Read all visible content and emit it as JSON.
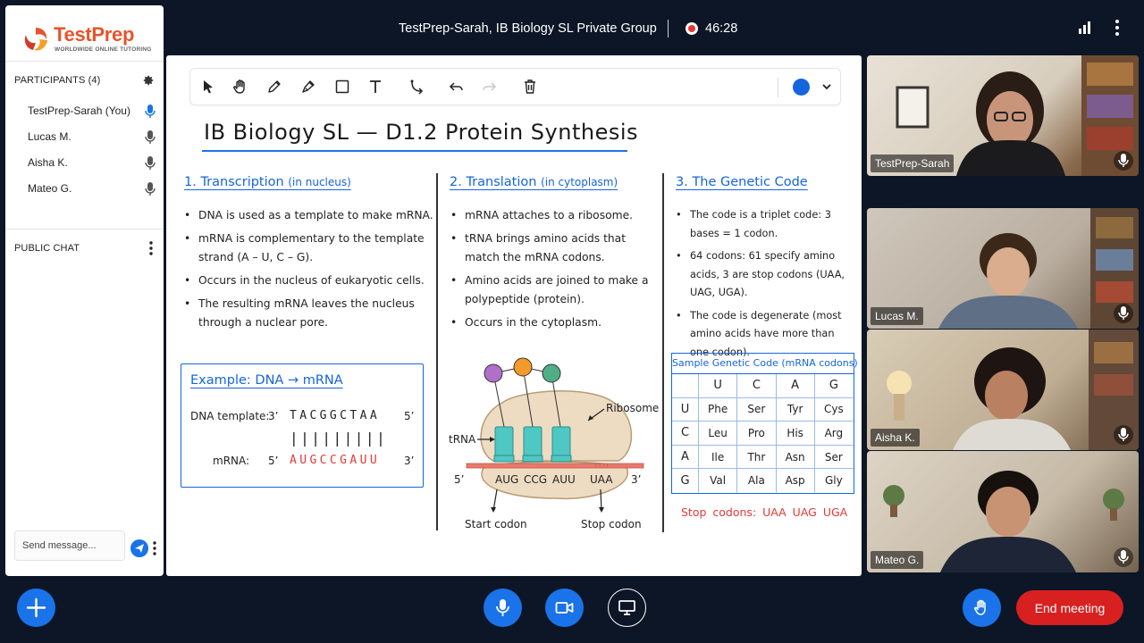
{
  "brand": {
    "name": "TestPrep",
    "tagline": "WORLDWIDE ONLINE TUTORING",
    "accent_orange": "#e8532b",
    "accent_blue": "#1a73e8"
  },
  "topbar": {
    "title": "TestPrep-Sarah, IB Biology SL Private Group",
    "timer": "46:28",
    "recording_icon": "record-icon",
    "signal_icon": "signal-bars-icon",
    "more_icon": "more-vertical-icon"
  },
  "sidebar": {
    "participants_header": "PARTICIPANTS (4)",
    "participants": [
      {
        "name": "TestPrep-Sarah (You)",
        "mic": "active"
      },
      {
        "name": "Lucas M.",
        "mic": "on"
      },
      {
        "name": "Aisha K.",
        "mic": "on"
      },
      {
        "name": "Mateo G.",
        "mic": "on"
      }
    ],
    "chat_header": "PUBLIC CHAT",
    "chat_placeholder": "Send message..."
  },
  "whiteboard": {
    "title": "IB Biology SL — D1.2 Protein Synthesis",
    "tools": [
      "select-icon",
      "hand-icon",
      "pencil-icon",
      "marker-icon",
      "rectangle-icon",
      "text-icon",
      "connector-icon",
      "undo-icon",
      "redo-icon",
      "trash-icon"
    ],
    "pen_color": "#1565e0",
    "sections": [
      {
        "heading": "1. Transcription",
        "heading_note": "(in nucleus)",
        "bullets": [
          "DNA is used as a template to make mRNA.",
          "mRNA is complementary to the template strand (A – U, C – G).",
          "Occurs in the nucleus of eukaryotic cells.",
          "The resulting mRNA leaves the nucleus through a nuclear pore."
        ]
      },
      {
        "heading": "2. Translation",
        "heading_note": "(in cytoplasm)",
        "bullets": [
          "mRNA attaches to a ribosome.",
          "tRNA brings amino acids that match the mRNA codons.",
          "Amino acids are joined to make a polypeptide (protein).",
          "Occurs in the cytoplasm."
        ]
      },
      {
        "heading": "3. The Genetic Code",
        "heading_note": "",
        "bullets": [
          "The code is a triplet code: 3 bases = 1 codon.",
          "64 codons: 61 specify amino acids, 3 are stop codons (UAA, UAG, UGA).",
          "The code is degenerate (most amino acids have more than one codon)."
        ]
      }
    ],
    "example": {
      "title": "Example: DNA → mRNA",
      "dna_label": "DNA template:",
      "dna_5prime": "3’",
      "dna_seq": "TACGGCTAA",
      "dna_3prime": "5’",
      "pairs": "|||||||||",
      "mrna_label": "mRNA:",
      "mrna_5prime": "5’",
      "mrna_seq": "AUGCCGAUU",
      "mrna_3prime": "3’"
    },
    "diagram": {
      "ribosome_label": "Ribosome",
      "trna_label": "tRNA",
      "end_5": "5’",
      "end_3": "3’",
      "codons": [
        "AUG",
        "CCG",
        "AUU",
        "UAA"
      ],
      "start_label": "Start codon",
      "stop_label": "Stop codon",
      "amino_colors": [
        "#b06fc9",
        "#f39a2b",
        "#4fae86"
      ]
    },
    "genetic_code_table": {
      "caption": "Sample Genetic Code (mRNA codons)",
      "columns": [
        "U",
        "C",
        "A",
        "G"
      ],
      "rows": [
        {
          "first": "U",
          "cells": [
            "Phe",
            "Ser",
            "Tyr",
            "Cys"
          ]
        },
        {
          "first": "C",
          "cells": [
            "Leu",
            "Pro",
            "His",
            "Arg"
          ]
        },
        {
          "first": "A",
          "cells": [
            "Ile",
            "Thr",
            "Asn",
            "Ser"
          ]
        },
        {
          "first": "G",
          "cells": [
            "Val",
            "Ala",
            "Asp",
            "Gly"
          ]
        }
      ],
      "stop_codons_line": "Stop codons: UAA UAG UGA"
    }
  },
  "videos": [
    {
      "name": "TestPrep-Sarah"
    },
    {
      "name": "Lucas M."
    },
    {
      "name": "Aisha K."
    },
    {
      "name": "Mateo G."
    }
  ],
  "controls": {
    "add_icon": "plus-icon",
    "mic_icon": "microphone-icon",
    "camera_icon": "camera-icon",
    "screen_icon": "screen-share-icon",
    "raise_hand_icon": "raise-hand-icon",
    "end_label": "End meeting",
    "end_color": "#d92020"
  }
}
